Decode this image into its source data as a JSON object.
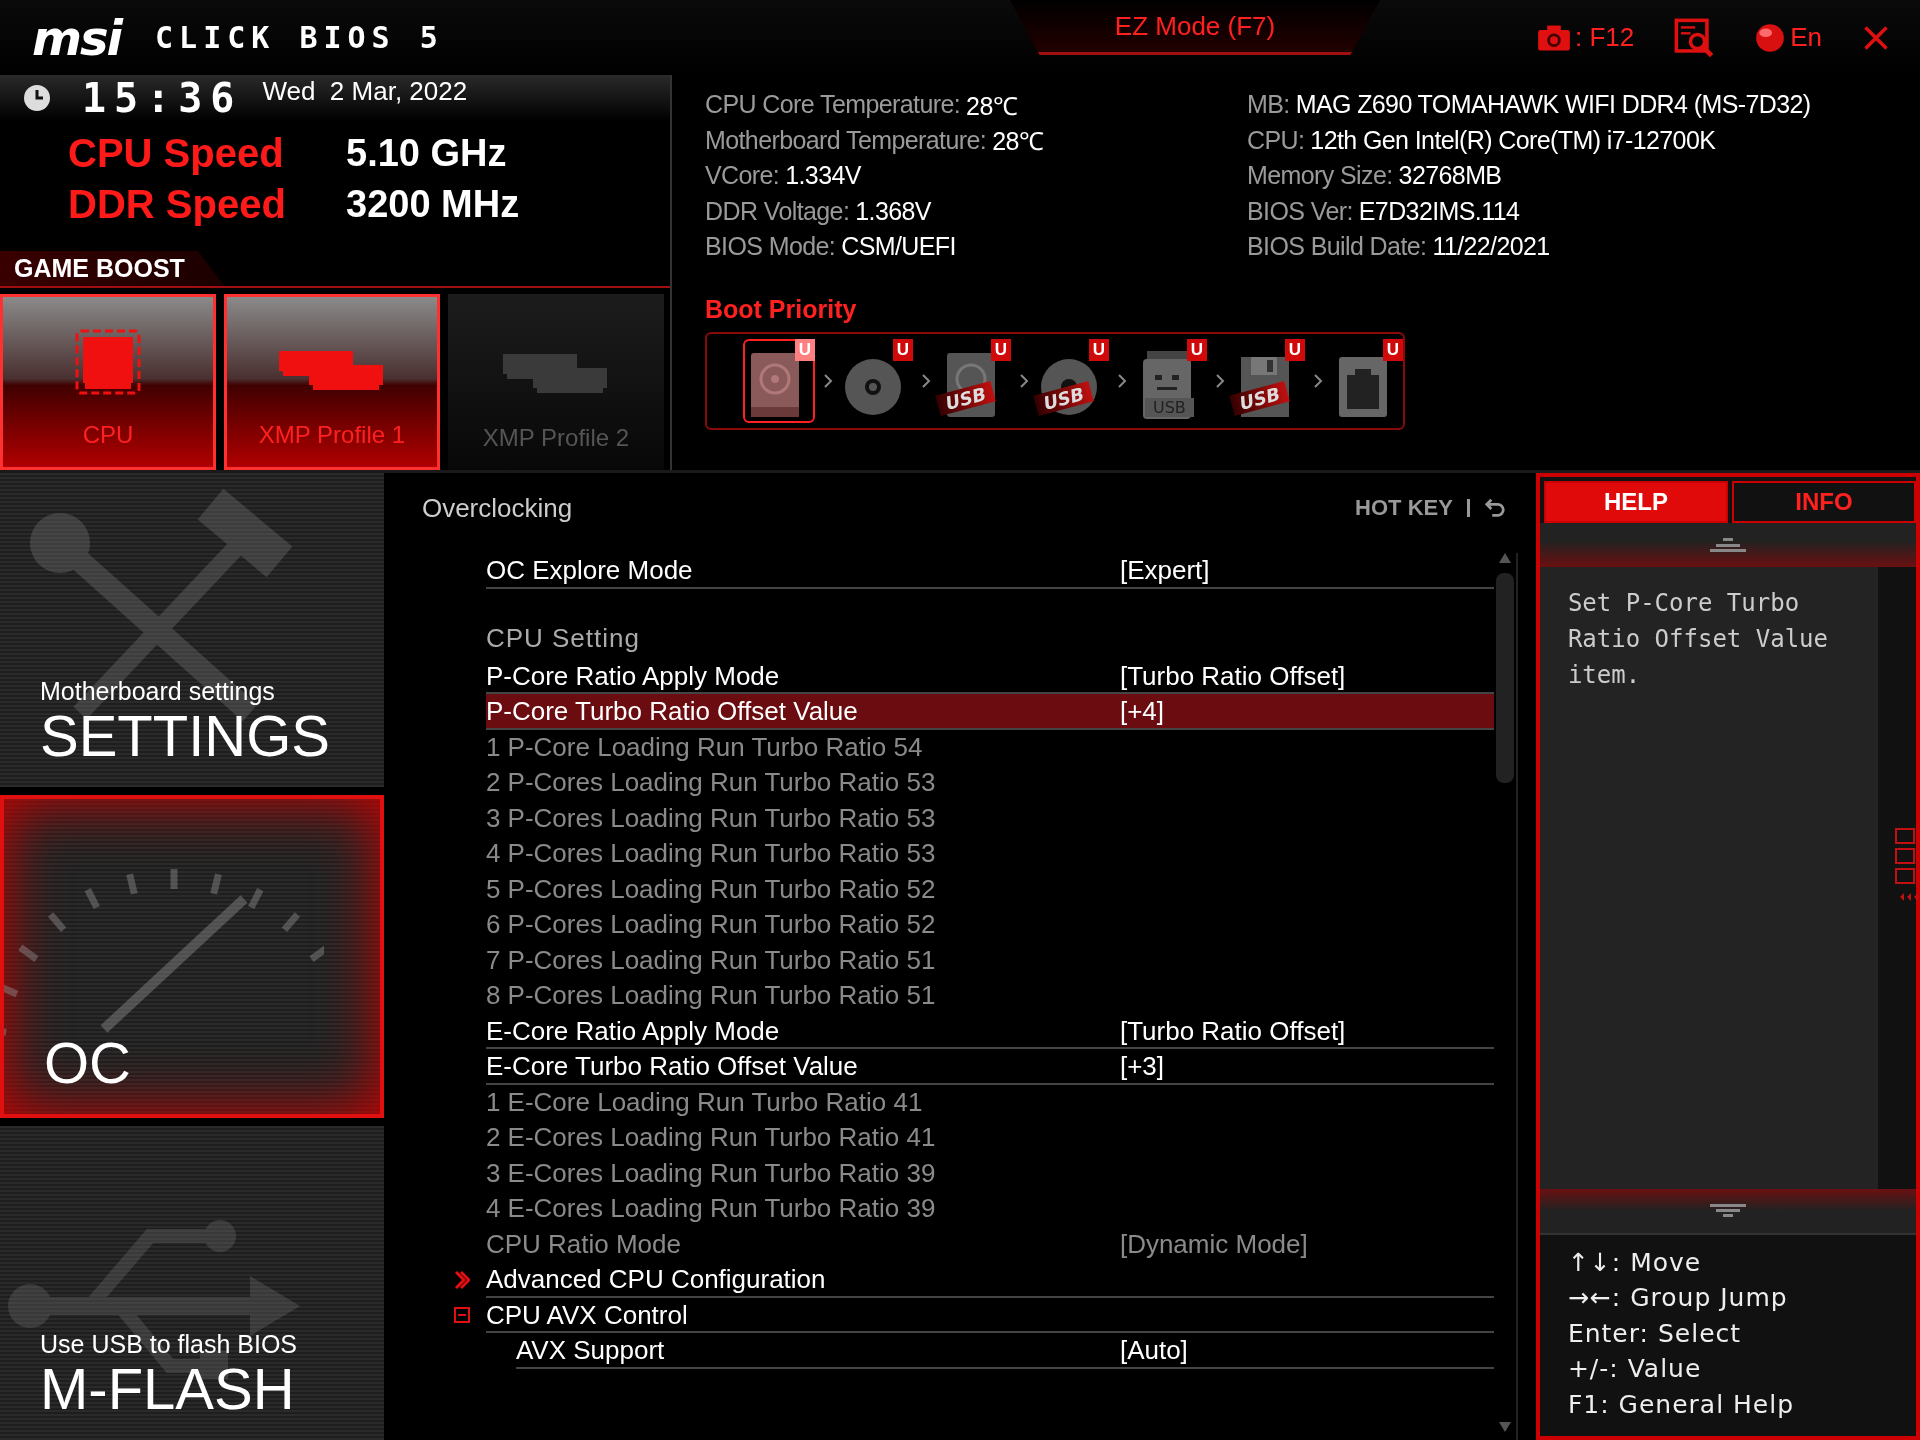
{
  "window": {
    "logo": "msi",
    "title": "CLICK BIOS 5"
  },
  "top_bar": {
    "ez_mode": "EZ Mode (F7)",
    "screenshot_key": ": F12",
    "language": "En"
  },
  "clock": {
    "time": "15:36",
    "date": "Wed  2 Mar, 2022"
  },
  "speeds": [
    {
      "label": "CPU Speed",
      "value": "5.10 GHz"
    },
    {
      "label": "DDR Speed",
      "value": "3200 MHz"
    }
  ],
  "game_boost": {
    "title": "GAME BOOST",
    "profiles": [
      {
        "label": "CPU",
        "kind": "cpu",
        "on": true
      },
      {
        "label": "XMP Profile 1",
        "kind": "memory",
        "on": true
      },
      {
        "label": "XMP Profile 2",
        "kind": "memory",
        "on": false
      }
    ]
  },
  "system_info": {
    "columns": [
      [
        {
          "label": "CPU Core Temperature:",
          "value": "28℃"
        },
        {
          "label": "Motherboard Temperature:",
          "value": "28℃"
        },
        {
          "label": "VCore:",
          "value": "1.334V"
        },
        {
          "label": "DDR Voltage:",
          "value": "1.368V"
        },
        {
          "label": "BIOS Mode:",
          "value": "CSM/UEFI"
        }
      ],
      [
        {
          "label": "MB:",
          "value": "MAG Z690 TOMAHAWK WIFI DDR4 (MS-7D32)"
        },
        {
          "label": "CPU:",
          "value": "12th Gen Intel(R) Core(TM) i7-12700K"
        },
        {
          "label": "Memory Size:",
          "value": "32768MB"
        },
        {
          "label": "BIOS Ver:",
          "value": "E7D32IMS.114"
        },
        {
          "label": "BIOS Build Date:",
          "value": "11/22/2021"
        }
      ]
    ]
  },
  "boot_priority": {
    "title": "Boot Priority",
    "devices": [
      {
        "kind": "hdd",
        "badge": "U",
        "selected": true
      },
      {
        "kind": "optical",
        "badge": "U",
        "selected": false
      },
      {
        "kind": "usb-hdd",
        "badge": "U",
        "ribbon": "USB",
        "selected": false
      },
      {
        "kind": "usb-optical",
        "badge": "U",
        "ribbon": "USB",
        "selected": false
      },
      {
        "kind": "usb-key",
        "badge": "U",
        "ribbon": "USB",
        "selected": false
      },
      {
        "kind": "usb-floppy",
        "badge": "U",
        "ribbon": "USB",
        "selected": false
      },
      {
        "kind": "network",
        "badge": "U",
        "selected": false
      }
    ]
  },
  "sidebar": {
    "items": [
      {
        "kind": "settings",
        "subtitle": "Motherboard settings",
        "title": "SETTINGS",
        "selected": false
      },
      {
        "kind": "oc",
        "title": "OC",
        "selected": true
      },
      {
        "kind": "mflash",
        "subtitle": "Use USB to flash BIOS",
        "title": "M-FLASH",
        "selected": false
      }
    ]
  },
  "panel": {
    "title": "Overclocking",
    "hotkey": "HOT KEY",
    "rows": [
      {
        "kind": "setting",
        "label": "OC Explore Mode",
        "value": "[Expert]",
        "selected": false,
        "disabled": false
      },
      {
        "kind": "section",
        "label": "CPU  Setting"
      },
      {
        "kind": "setting",
        "label": "P-Core Ratio Apply Mode",
        "value": "[Turbo Ratio Offset]",
        "selected": false,
        "disabled": false
      },
      {
        "kind": "setting",
        "label": "P-Core Turbo Ratio Offset Value",
        "value": "[+4]",
        "selected": true,
        "disabled": false
      },
      {
        "kind": "setting",
        "label": "1 P-Core Loading Run Turbo Ratio 54",
        "selected": false,
        "disabled": true
      },
      {
        "kind": "setting",
        "label": "2 P-Cores Loading Run Turbo Ratio 53",
        "selected": false,
        "disabled": true
      },
      {
        "kind": "setting",
        "label": "3 P-Cores Loading Run Turbo Ratio 53",
        "selected": false,
        "disabled": true
      },
      {
        "kind": "setting",
        "label": "4 P-Cores Loading Run Turbo Ratio 53",
        "selected": false,
        "disabled": true
      },
      {
        "kind": "setting",
        "label": "5 P-Cores Loading Run Turbo Ratio 52",
        "selected": false,
        "disabled": true
      },
      {
        "kind": "setting",
        "label": "6 P-Cores Loading Run Turbo Ratio 52",
        "selected": false,
        "disabled": true
      },
      {
        "kind": "setting",
        "label": "7 P-Cores Loading Run Turbo Ratio 51",
        "selected": false,
        "disabled": true
      },
      {
        "kind": "setting",
        "label": "8 P-Cores Loading Run Turbo Ratio 51",
        "selected": false,
        "disabled": true
      },
      {
        "kind": "setting",
        "label": "E-Core Ratio Apply Mode",
        "value": "[Turbo Ratio Offset]",
        "selected": false,
        "disabled": false
      },
      {
        "kind": "setting",
        "label": "E-Core Turbo Ratio Offset Value",
        "value": "[+3]",
        "selected": false,
        "disabled": false
      },
      {
        "kind": "setting",
        "label": "1 E-Core Loading Run Turbo Ratio 41",
        "selected": false,
        "disabled": true
      },
      {
        "kind": "setting",
        "label": "2 E-Cores Loading Run Turbo Ratio 41",
        "selected": false,
        "disabled": true
      },
      {
        "kind": "setting",
        "label": "3 E-Cores Loading Run Turbo Ratio 39",
        "selected": false,
        "disabled": true
      },
      {
        "kind": "setting",
        "label": "4 E-Cores Loading Run Turbo Ratio 39",
        "selected": false,
        "disabled": true
      },
      {
        "kind": "setting",
        "label": "CPU Ratio Mode",
        "value": "[Dynamic Mode]",
        "selected": false,
        "disabled": true
      },
      {
        "kind": "submenu",
        "label": "Advanced CPU Configuration",
        "selected": false,
        "disabled": false
      },
      {
        "kind": "group",
        "label": "CPU AVX Control",
        "expanded": true,
        "selected": false,
        "disabled": false,
        "children": [
          {
            "label": "AVX Support",
            "value": "[Auto]",
            "selected": false,
            "disabled": false
          }
        ]
      }
    ]
  },
  "help": {
    "tabs": [
      {
        "label": "HELP",
        "selected": true
      },
      {
        "label": "INFO",
        "selected": false
      }
    ],
    "text": "Set P-Core Turbo Ratio Offset Value item.",
    "hints": [
      "↑↓: Move",
      "→←: Group Jump",
      "Enter: Select",
      "+/-: Value",
      "F1: General Help"
    ]
  }
}
